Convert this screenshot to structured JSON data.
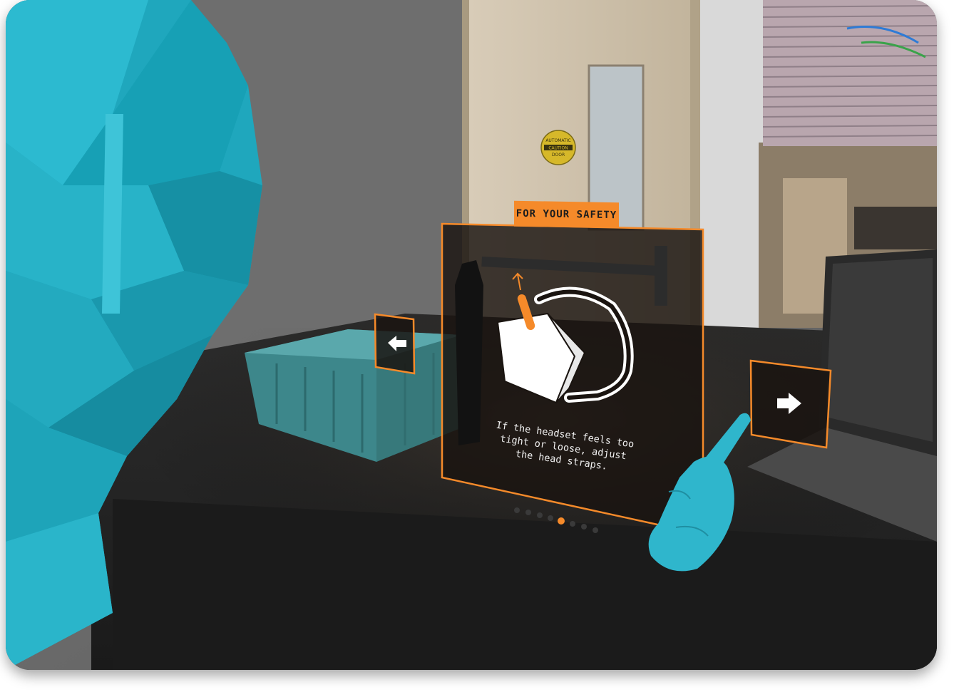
{
  "scene": {
    "environment": "vr-office",
    "colors": {
      "accent": "#f58a2a",
      "hand": "#2fb6cc",
      "avatar": "#1fa7bd",
      "bin": "#3f8f93",
      "desk": "#242424",
      "wall": "#6a6a6a"
    }
  },
  "door_sign": {
    "line1": "AUTOMATIC",
    "line2": "CAUTION",
    "line3": "DOOR"
  },
  "safety_panel": {
    "tab_label": "FOR YOUR SAFETY",
    "message": "If the headset feels too tight or loose, adjust the head straps.",
    "illustration": "vr-headset-strap-icon",
    "pagination": {
      "total": 8,
      "current": 5
    }
  },
  "navigation": {
    "previous_icon": "arrow-left-icon",
    "next_icon": "arrow-right-icon"
  }
}
